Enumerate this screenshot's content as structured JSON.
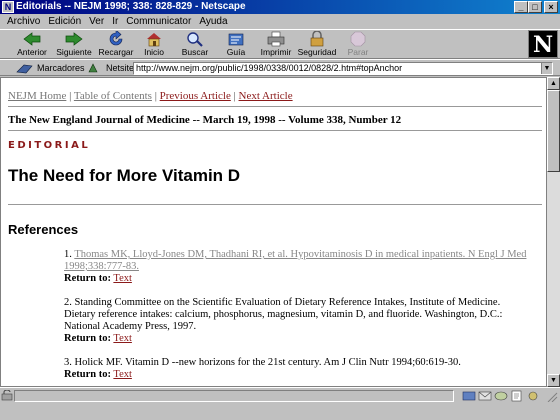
{
  "window": {
    "title": "Editorials -- NEJM 1998; 338: 828-829 - Netscape"
  },
  "menu": [
    "Archivo",
    "Edición",
    "Ver",
    "Ir",
    "Communicator",
    "Ayuda"
  ],
  "toolbar": [
    {
      "label": "Anterior",
      "icon": "back-arrow-icon"
    },
    {
      "label": "Siguiente",
      "icon": "forward-arrow-icon"
    },
    {
      "label": "Recargar",
      "icon": "reload-icon"
    },
    {
      "label": "Inicio",
      "icon": "home-icon"
    },
    {
      "label": "Buscar",
      "icon": "search-icon"
    },
    {
      "label": "Guía",
      "icon": "guide-icon"
    },
    {
      "label": "Imprimir",
      "icon": "print-icon"
    },
    {
      "label": "Seguridad",
      "icon": "security-lock-icon"
    },
    {
      "label": "Parar",
      "icon": "stop-icon",
      "disabled": true
    }
  ],
  "location": {
    "bookmarks_label": "Marcadores",
    "netsite_label": "Netsite:",
    "url": "http://www.nejm.org/public/1998/0338/0012/0828/2.htm#topAnchor"
  },
  "page": {
    "nav": {
      "home": "NEJM Home",
      "toc": "Table of Contents",
      "prev": "Previous Article",
      "next": "Next Article"
    },
    "journal_line": "The New England Journal of Medicine -- March 19, 1998 -- Volume 338, Number 12",
    "section_tag": "Editorial",
    "title": "The Need for More Vitamin D",
    "references_heading": "References",
    "return_label": "Return to:",
    "return_link": "Text",
    "references": [
      {
        "number": "1.",
        "text": "Thomas MK, Lloyd-Jones DM, Thadhani RI, et al. Hypovitaminosis D in medical inpatients. N Engl J Med 1998;338:777-83."
      },
      {
        "number": "2.",
        "text": "Standing Committee on the Scientific Evaluation of Dietary Reference Intakes, Institute of Medicine. Dietary reference intakes: calcium, phosphorus, magnesium, vitamin D, and fluoride. Washington, D.C.: National Academy Press, 1997."
      },
      {
        "number": "3.",
        "text": "Holick MF. Vitamin D --new horizons for the 21st century. Am J Clin Nutr 1994;60:619-30."
      }
    ]
  },
  "colors": {
    "link": "#8b1a1a",
    "visited": "#888888",
    "titlebar": "#000080"
  }
}
